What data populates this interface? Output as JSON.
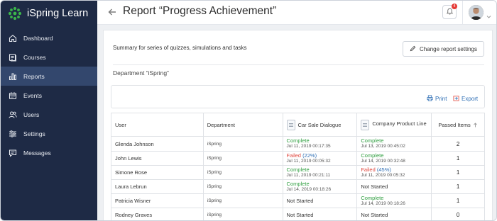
{
  "app": {
    "name": "iSpring Learn"
  },
  "sidebar": {
    "items": [
      {
        "label": "Dashboard",
        "icon": "home-icon"
      },
      {
        "label": "Courses",
        "icon": "courses-icon"
      },
      {
        "label": "Reports",
        "icon": "bar-chart-icon",
        "active": true
      },
      {
        "label": "Events",
        "icon": "calendar-icon"
      },
      {
        "label": "Users",
        "icon": "users-icon"
      },
      {
        "label": "Settings",
        "icon": "sliders-icon"
      },
      {
        "label": "Messages",
        "icon": "message-icon"
      }
    ]
  },
  "header": {
    "title": "Report “Progress Achievement”",
    "notification_count": "4"
  },
  "panel": {
    "summary": "Summary for series of quizzes, simulations and tasks",
    "change_button": "Change report settings",
    "department": "Department “iSpring”",
    "print_label": "Print",
    "export_label": "Export"
  },
  "table": {
    "headers": {
      "user": "User",
      "department": "Department",
      "car_sale": "Car Sale Dialogue",
      "company_product": "Company Product Line",
      "passed": "Passed Items"
    },
    "rows": [
      {
        "user": "Glenda Johnson",
        "department": "iSpring",
        "car_status": "Complete",
        "car_pct": "",
        "car_date": "Jul 11, 2019 00:17:35",
        "comp_status": "Complete",
        "comp_pct": "",
        "comp_date": "Jul 13, 2019 00:45:02",
        "passed": "2"
      },
      {
        "user": "John Lewis",
        "department": "iSpring",
        "car_status": "Failed",
        "car_pct": "(22%)",
        "car_date": "Jul 11, 2019 00:05:32",
        "comp_status": "Complete",
        "comp_pct": "",
        "comp_date": "Jul 14, 2019 00:32:48",
        "passed": "1"
      },
      {
        "user": "Simone Rose",
        "department": "iSpring",
        "car_status": "Complete",
        "car_pct": "",
        "car_date": "Jul 11, 2019 00:21:11",
        "comp_status": "Failed",
        "comp_pct": "(45%)",
        "comp_date": "Jul 11, 2019 00:05:32",
        "passed": "1"
      },
      {
        "user": "Laura Lebrun",
        "department": "iSpring",
        "car_status": "Complete",
        "car_pct": "",
        "car_date": "Jul 14, 2019 00:18:26",
        "comp_status": "Not Started",
        "comp_pct": "",
        "comp_date": "",
        "passed": "1"
      },
      {
        "user": "Patricia Wisner",
        "department": "iSpring",
        "car_status": "Not Started",
        "car_pct": "",
        "car_date": "",
        "comp_status": "Complete",
        "comp_pct": "",
        "comp_date": "Jul 14, 2019 00:18:26",
        "passed": "1"
      },
      {
        "user": "Rodney Graves",
        "department": "iSpring",
        "car_status": "Not Started",
        "car_pct": "",
        "car_date": "",
        "comp_status": "Not Started",
        "comp_pct": "",
        "comp_date": "",
        "passed": "0"
      }
    ]
  },
  "colors": {
    "sidebar_bg": "#1e2a45",
    "sidebar_active": "#33476d",
    "logo_green": "#3bb54a",
    "complete_green": "#2e9e3f",
    "failed_red": "#e0483f",
    "link_blue": "#2f6fb5",
    "badge_red": "#e53935"
  }
}
